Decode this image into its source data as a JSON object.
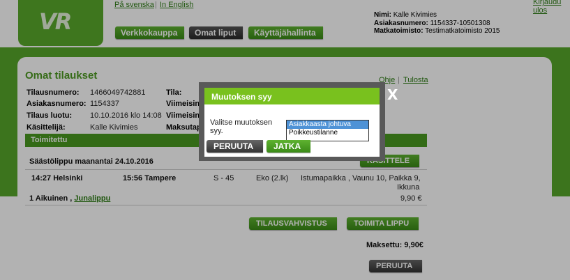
{
  "header": {
    "logo": "VR",
    "lang_sv": "På svenska",
    "lang_en": "In English",
    "logout": "Kirjaudu ulos",
    "nav": [
      "Verkkokauppa",
      "Omat liput",
      "Käyttäjähallinta"
    ],
    "user_info": {
      "name_label": "Nimi:",
      "name_value": "Kalle Kivimies",
      "customer_label": "Asiakasnumero:",
      "customer_value": "1154337-10501308",
      "agency_label": "Matkatoimisto:",
      "agency_value": "Testimatkatoimisto 2015"
    }
  },
  "page": {
    "title": "Omat tilaukset",
    "help": "Ohje",
    "print": "Tulosta",
    "fields": {
      "order_no_label": "Tilausnumero:",
      "order_no_value": "1466049742881",
      "customer_label": "Asiakasnumero:",
      "customer_value": "1154337",
      "created_label": "Tilaus luotu:",
      "created_value": "10.10.2016 klo 14:08",
      "handler_label": "Käsittelijä:",
      "handler_value": "Kalle Kivimies",
      "status_label": "Tila:",
      "latest1_label": "Viimeisin",
      "latest2_label": "Viimeisin",
      "payment_label": "Maksutap"
    },
    "section_title": "Toimitettu",
    "ticket_title": "Säästölippu maanantai 24.10.2016",
    "handle_button": "KÄSITTELE",
    "segment": {
      "dep": "14:27 Helsinki",
      "arr": "15:56 Tampere",
      "train": "S - 45",
      "class": "Eko (2.lk)",
      "seat_line1": "Istumapaikka , Vaunu 10, Paikka 9,",
      "seat_line2": "Ikkuna"
    },
    "passenger": "1 Aikuinen ,",
    "passenger_link": "Junalippu",
    "price": "9,90 €",
    "confirm_button": "TILAUSVAHVISTUS",
    "deliver_button": "TOIMITA LIPPU",
    "paid": "Maksettu: 9,90€",
    "cancel_button": "PERUUTA"
  },
  "modal": {
    "title": "Muutoksen syy",
    "close": "X",
    "label": "Valitse muutoksen syy.",
    "options": [
      "Asiakkaasta johtuva",
      "Poikkeustilanne"
    ],
    "selected_index": 0,
    "cancel_button": "PERUUTA",
    "continue_button": "JATKA"
  }
}
